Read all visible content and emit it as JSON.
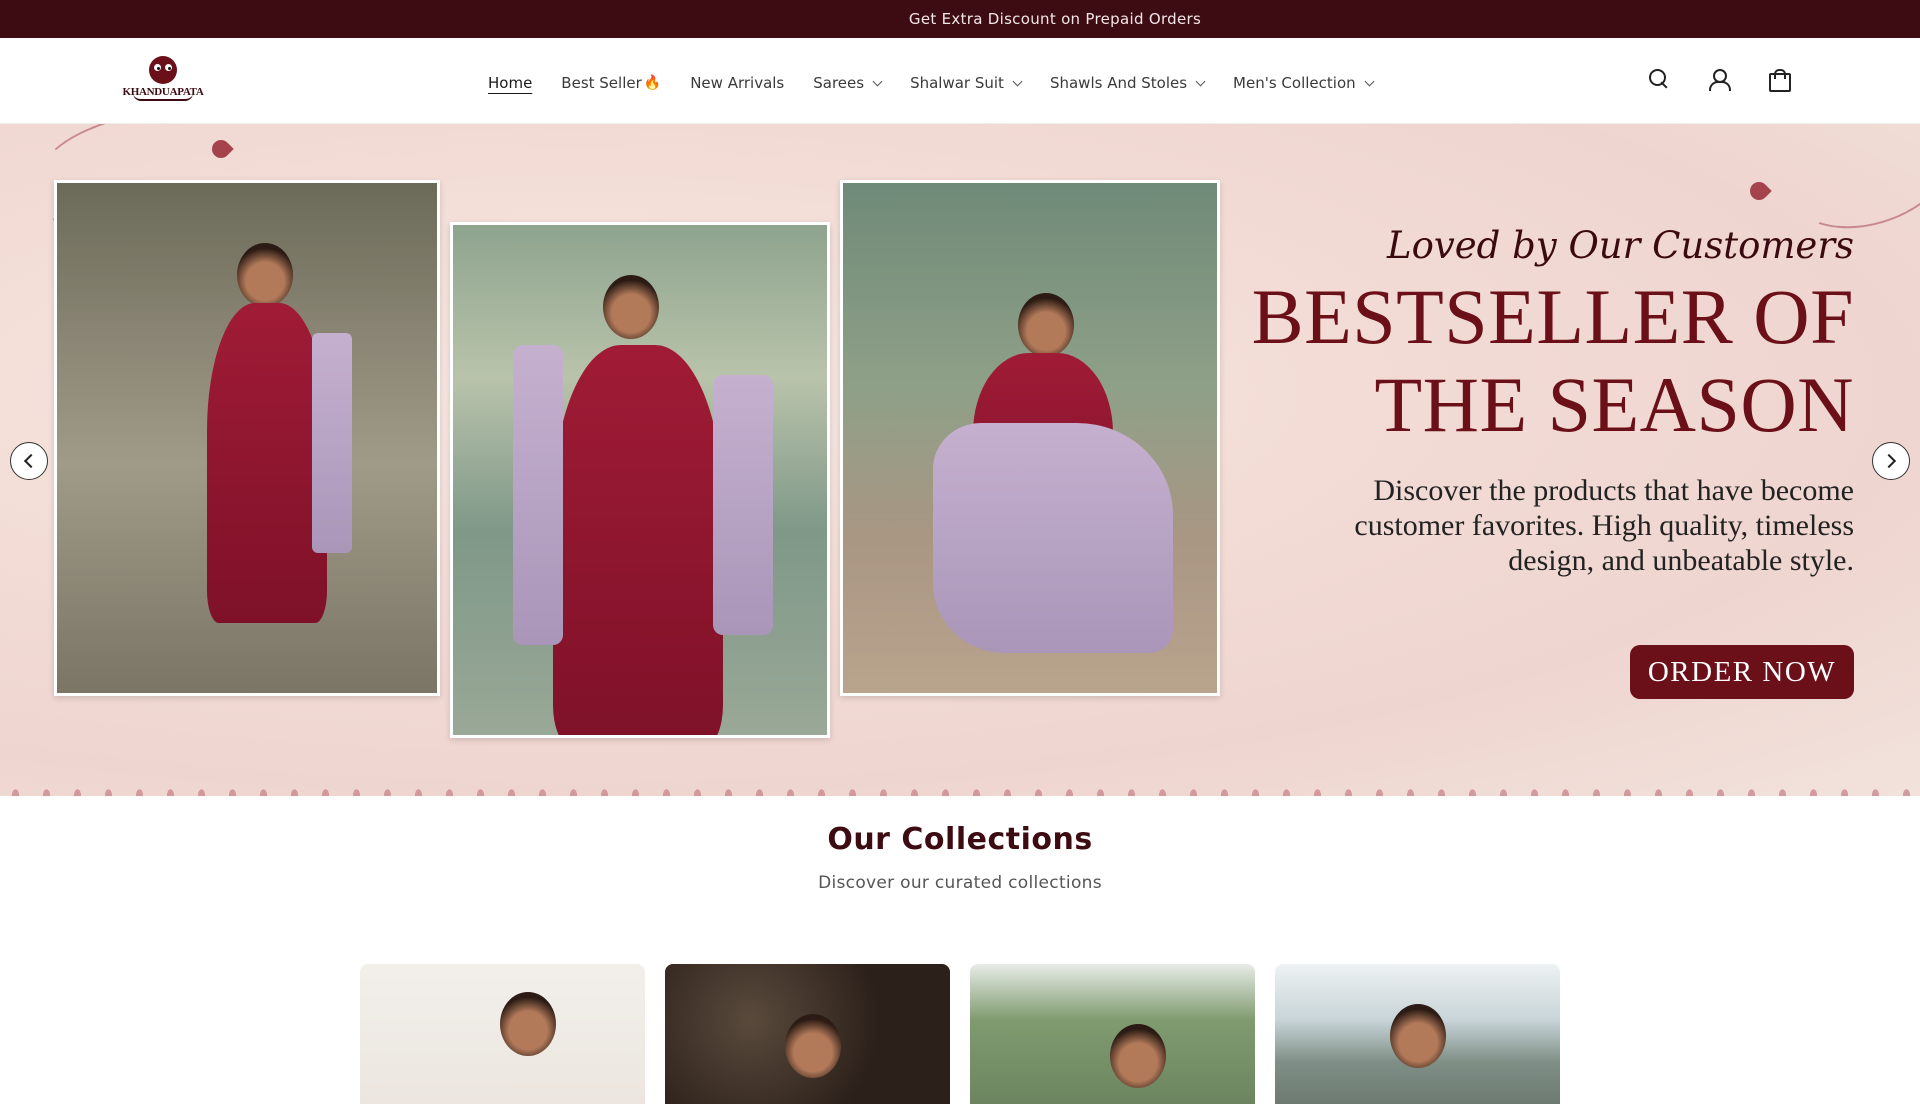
{
  "announcement": "Get Extra Discount on Prepaid Orders",
  "brand": {
    "name": "KHANDUAPATA"
  },
  "nav": {
    "items": [
      {
        "label": "Home",
        "dropdown": false,
        "active": true
      },
      {
        "label": "Best Seller",
        "dropdown": false,
        "active": false,
        "badge": "🔥"
      },
      {
        "label": "New Arrivals",
        "dropdown": false,
        "active": false
      },
      {
        "label": "Sarees",
        "dropdown": true,
        "active": false
      },
      {
        "label": "Shalwar Suit",
        "dropdown": true,
        "active": false
      },
      {
        "label": "Shawls And Stoles",
        "dropdown": true,
        "active": false
      },
      {
        "label": "Men's Collection",
        "dropdown": true,
        "active": false
      }
    ]
  },
  "header_icons": [
    "search-icon",
    "account-icon",
    "cart-icon"
  ],
  "hero": {
    "tagline": "Loved by Our Customers",
    "headline_line1": "BESTSELLER OF",
    "headline_line2": "THE SEASON",
    "description": "Discover the products that have become customer favorites. High quality, timeless design, and unbeatable style.",
    "cta": "ORDER NOW"
  },
  "collections": {
    "title": "Our Collections",
    "subtitle": "Discover our curated collections"
  },
  "colors": {
    "brand_dark": "#3d0c12",
    "brand_maroon": "#6b0f18",
    "hero_bg": "#f3dcd6"
  }
}
